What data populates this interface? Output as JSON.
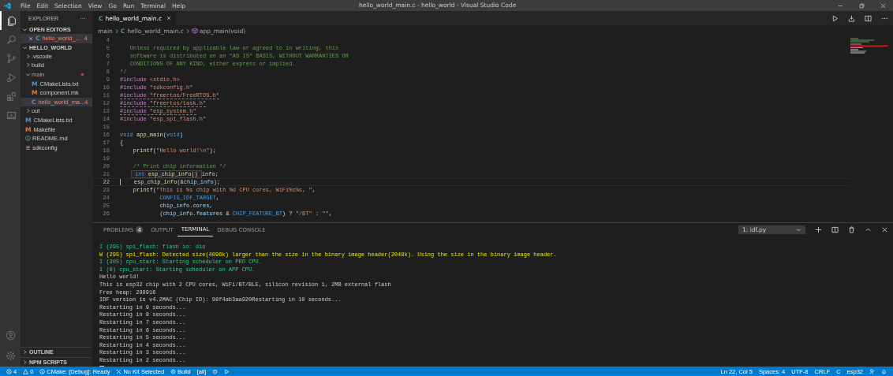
{
  "title_bar": {
    "menu": [
      "File",
      "Edit",
      "Selection",
      "View",
      "Go",
      "Run",
      "Terminal",
      "Help"
    ],
    "title": "hello_world_main.c - hello_world - Visual Studio Code"
  },
  "activity_bar": [
    {
      "kind": "explorer",
      "selected": true
    },
    {
      "kind": "search",
      "selected": false
    },
    {
      "kind": "source-control",
      "selected": false
    },
    {
      "kind": "run",
      "selected": false
    },
    {
      "kind": "extensions",
      "selected": false
    },
    {
      "kind": "remote",
      "selected": false
    }
  ],
  "sidebar": {
    "title": "EXPLORER",
    "more": "···",
    "open_editors": {
      "title": "OPEN EDITORS",
      "expanded": true,
      "items": [
        {
          "glyph": "C",
          "label": "hello_world_...",
          "kind": "c",
          "error": true,
          "badge": "4"
        }
      ]
    },
    "folder": {
      "title": "HELLO_WORLD",
      "expanded": true,
      "tree": [
        {
          "label": ".vscode",
          "kind": "folder",
          "expanded": false,
          "error": false,
          "selected": false
        },
        {
          "label": "build",
          "kind": "folder",
          "expanded": false,
          "error": false,
          "selected": false
        },
        {
          "label": "main",
          "kind": "folder",
          "expanded": true,
          "error": true,
          "selected": false,
          "children": [
            {
              "glyph": "M",
              "label": "CMakeLists.txt",
              "kind": "cmake",
              "error": false,
              "selected": false
            },
            {
              "glyph": "M",
              "label": "component.mk",
              "kind": "make",
              "error": false,
              "selected": false
            },
            {
              "glyph": "C",
              "label": "hello_world_ma...",
              "kind": "c",
              "error": true,
              "badge": "4",
              "selected": true
            }
          ]
        },
        {
          "label": "out",
          "kind": "folder",
          "expanded": false,
          "error": false,
          "selected": false
        },
        {
          "glyph": "M",
          "label": "CMakeLists.txt",
          "kind": "cmake",
          "error": false,
          "selected": false
        },
        {
          "glyph": "M",
          "label": "Makefile",
          "kind": "make",
          "error": false,
          "selected": false
        },
        {
          "label": "README.md",
          "kind": "readme",
          "error": false,
          "selected": false
        },
        {
          "label": "sdkconfig",
          "kind": "config",
          "error": false,
          "selected": false
        }
      ]
    },
    "collapsed_sections": [
      {
        "title": "OUTLINE",
        "expanded": false
      },
      {
        "title": "NPM SCRIPTS",
        "expanded": false
      }
    ]
  },
  "editor": {
    "tabs": [
      {
        "glyph": "C",
        "label": "hello_world_main.c",
        "selected": true
      }
    ],
    "breadcrumb": [
      {
        "label": "main",
        "kind": "folder"
      },
      {
        "glyph": "C",
        "label": "hello_world_main.c",
        "kind": "c"
      },
      {
        "label": "app_main(void)",
        "kind": "function"
      }
    ],
    "lines": [
      {
        "number": "4",
        "current": false
      },
      {
        "number": "5",
        "current": false,
        "squiggle": false,
        "segments": [
          {
            "text": "   Unless required by applicable law or agreed to in writing, this",
            "kind": "comment"
          }
        ]
      },
      {
        "number": "6",
        "current": false,
        "squiggle": false,
        "segments": [
          {
            "text": "   software is distributed on an \"AS IS\" BASIS, WITHOUT WARRANTIES OR",
            "kind": "comment"
          }
        ]
      },
      {
        "number": "7",
        "current": false,
        "squiggle": false,
        "segments": [
          {
            "text": "   CONDITIONS OF ANY KIND, either express or implied.",
            "kind": "comment"
          }
        ]
      },
      {
        "number": "8",
        "current": false,
        "squiggle": false,
        "segments": [
          {
            "text": "*/",
            "kind": "comment"
          }
        ]
      },
      {
        "number": "9",
        "current": false,
        "squiggle": false,
        "segments": [
          {
            "text": "#include",
            "kind": "directive"
          },
          {
            "text": " <stdio.h>",
            "kind": "string"
          }
        ]
      },
      {
        "number": "10",
        "current": false,
        "squiggle": false,
        "segments": [
          {
            "text": "#include",
            "kind": "directive"
          },
          {
            "text": " \"sdkconfig.h\"",
            "kind": "string"
          }
        ]
      },
      {
        "number": "11",
        "current": false,
        "squiggle": true,
        "segments": [
          {
            "text": "#include",
            "kind": "directive"
          },
          {
            "text": " \"freertos/FreeRTOS.h\"",
            "kind": "string"
          }
        ]
      },
      {
        "number": "12",
        "current": false,
        "squiggle": true,
        "segments": [
          {
            "text": "#include",
            "kind": "directive"
          },
          {
            "text": " \"freertos/task.h\"",
            "kind": "string"
          }
        ]
      },
      {
        "number": "13",
        "current": false,
        "squiggle": true,
        "segments": [
          {
            "text": "#include",
            "kind": "directive"
          },
          {
            "text": " \"esp_system.h\"",
            "kind": "string"
          }
        ]
      },
      {
        "number": "14",
        "current": false,
        "squiggle": false,
        "segments": [
          {
            "text": "#include",
            "kind": "directive"
          },
          {
            "text": " \"esp_spi_flash.h\"",
            "kind": "string"
          }
        ]
      },
      {
        "number": "15",
        "current": false
      },
      {
        "number": "16",
        "current": false,
        "squiggle": false,
        "segments": [
          {
            "text": "void",
            "kind": "keyword"
          },
          {
            "text": " app_main",
            "kind": "func"
          },
          {
            "text": "(",
            "kind": "plain"
          },
          {
            "text": "void",
            "kind": "keyword"
          },
          {
            "text": ")",
            "kind": "plain"
          }
        ]
      },
      {
        "number": "17",
        "current": false,
        "squiggle": false,
        "segments": [
          {
            "text": "{",
            "kind": "plain"
          }
        ]
      },
      {
        "number": "18",
        "current": false,
        "squiggle": false,
        "segments": [
          {
            "text": "    printf",
            "kind": "func"
          },
          {
            "text": "(",
            "kind": "plain"
          },
          {
            "text": "\"Hello world!\\n\"",
            "kind": "string"
          },
          {
            "text": ");",
            "kind": "plain"
          }
        ]
      },
      {
        "number": "19",
        "current": false
      },
      {
        "number": "20",
        "current": false,
        "squiggle": false,
        "segments": [
          {
            "text": "    /* Print chip information */",
            "kind": "comment"
          }
        ]
      },
      {
        "number": "21",
        "current": false,
        "squiggle": false,
        "hover": [
          {
            "text": "int",
            "kind": "keyword"
          },
          {
            "text": " esp_chip_info()",
            "kind": "func"
          }
        ],
        "segments": [
          {
            "text": "info;",
            "kind": "plain"
          }
        ]
      },
      {
        "number": "22",
        "current": true,
        "squiggle": false,
        "segments": [
          {
            "text": "    esp_chip_info",
            "kind": "func"
          },
          {
            "text": "(&",
            "kind": "plain"
          },
          {
            "text": "chip_info",
            "kind": "var"
          },
          {
            "text": ");",
            "kind": "plain"
          }
        ]
      },
      {
        "number": "23",
        "current": false,
        "squiggle": false,
        "segments": [
          {
            "text": "    printf",
            "kind": "func"
          },
          {
            "text": "(",
            "kind": "plain"
          },
          {
            "text": "\"This is %s chip with %d CPU cores, WiFi%s%s, \"",
            "kind": "string"
          },
          {
            "text": ",",
            "kind": "plain"
          }
        ]
      },
      {
        "number": "24",
        "current": false,
        "squiggle": false,
        "segments": [
          {
            "text": "            CONFIG_IDF_TARGET",
            "kind": "keyword"
          },
          {
            "text": ",",
            "kind": "plain"
          }
        ]
      },
      {
        "number": "25",
        "current": false,
        "squiggle": false,
        "segments": [
          {
            "text": "            chip_info",
            "kind": "var"
          },
          {
            "text": ".",
            "kind": "plain"
          },
          {
            "text": "cores",
            "kind": "var"
          },
          {
            "text": ",",
            "kind": "plain"
          }
        ]
      },
      {
        "number": "26",
        "current": false,
        "squiggle": false,
        "segments": [
          {
            "text": "            (",
            "kind": "plain"
          },
          {
            "text": "chip_info",
            "kind": "var"
          },
          {
            "text": ".",
            "kind": "plain"
          },
          {
            "text": "features",
            "kind": "var"
          },
          {
            "text": " & ",
            "kind": "plain"
          },
          {
            "text": "CHIP_FEATURE_BT",
            "kind": "keyword"
          },
          {
            "text": ") ? ",
            "kind": "plain"
          },
          {
            "text": "\"/BT\"",
            "kind": "string"
          },
          {
            "text": " : ",
            "kind": "plain"
          },
          {
            "text": "\"\"",
            "kind": "string"
          },
          {
            "text": ",",
            "kind": "plain"
          }
        ]
      }
    ]
  },
  "panel": {
    "tabs": [
      {
        "label": "PROBLEMS",
        "badge": "4",
        "selected": false
      },
      {
        "label": "OUTPUT",
        "selected": false
      },
      {
        "label": "TERMINAL",
        "selected": true
      },
      {
        "label": "DEBUG CONSOLE",
        "selected": false
      }
    ],
    "terminal_select": "1: idf.py",
    "terminal": [
      {
        "text": "I (295) spi_flash: flash io: dio",
        "kind": "info"
      },
      {
        "text": "W (295) spi_flash: Detected size(4096k) larger than the size in the binary image header(2048k). Using the size in the binary image header.",
        "kind": "warn"
      },
      {
        "text": "I (305) cpu_start: Starting scheduler on PRO CPU.",
        "kind": "info"
      },
      {
        "text": "I (0) cpu_start: Starting scheduler on APP CPU.",
        "kind": "info"
      },
      {
        "text": "Hello world!",
        "kind": "plain"
      },
      {
        "text": "This is esp32 chip with 2 CPU cores, WiFi/BT/BLE, silicon revision 1, 2MB external flash",
        "kind": "plain"
      },
      {
        "text": "Free heap: 299916",
        "kind": "plain"
      },
      {
        "text": "IDF version is v4.2MAC (Chip ID): 98f4ab3aa920Restarting in 10 seconds...",
        "kind": "plain"
      },
      {
        "text": "Restarting in 9 seconds...",
        "kind": "plain"
      },
      {
        "text": "Restarting in 8 seconds...",
        "kind": "plain"
      },
      {
        "text": "Restarting in 7 seconds...",
        "kind": "plain"
      },
      {
        "text": "Restarting in 6 seconds...",
        "kind": "plain"
      },
      {
        "text": "Restarting in 5 seconds...",
        "kind": "plain"
      },
      {
        "text": "Restarting in 4 seconds...",
        "kind": "plain"
      },
      {
        "text": "Restarting in 3 seconds...",
        "kind": "plain"
      },
      {
        "text": "Restarting in 2 seconds...",
        "kind": "plain"
      }
    ]
  },
  "status_bar": {
    "left": [
      {
        "kind": "errors",
        "text": "4"
      },
      {
        "kind": "warnings",
        "text": "0"
      },
      {
        "kind": "cmake",
        "text": "CMake: [Debug]: Ready"
      },
      {
        "kind": "kit",
        "text": "No Kit Selected"
      },
      {
        "kind": "build",
        "text": "Build"
      },
      {
        "kind": "text",
        "text": "[all]"
      },
      {
        "kind": "debug"
      },
      {
        "kind": "play"
      }
    ],
    "right": [
      {
        "kind": "text",
        "text": "Ln 22, Col 5"
      },
      {
        "kind": "text",
        "text": "Spaces: 4"
      },
      {
        "kind": "text",
        "text": "UTF-8"
      },
      {
        "kind": "text",
        "text": "CRLF"
      },
      {
        "kind": "text",
        "text": "C"
      },
      {
        "kind": "text",
        "text": "esp32"
      },
      {
        "kind": "feedback"
      },
      {
        "kind": "bell"
      }
    ]
  }
}
